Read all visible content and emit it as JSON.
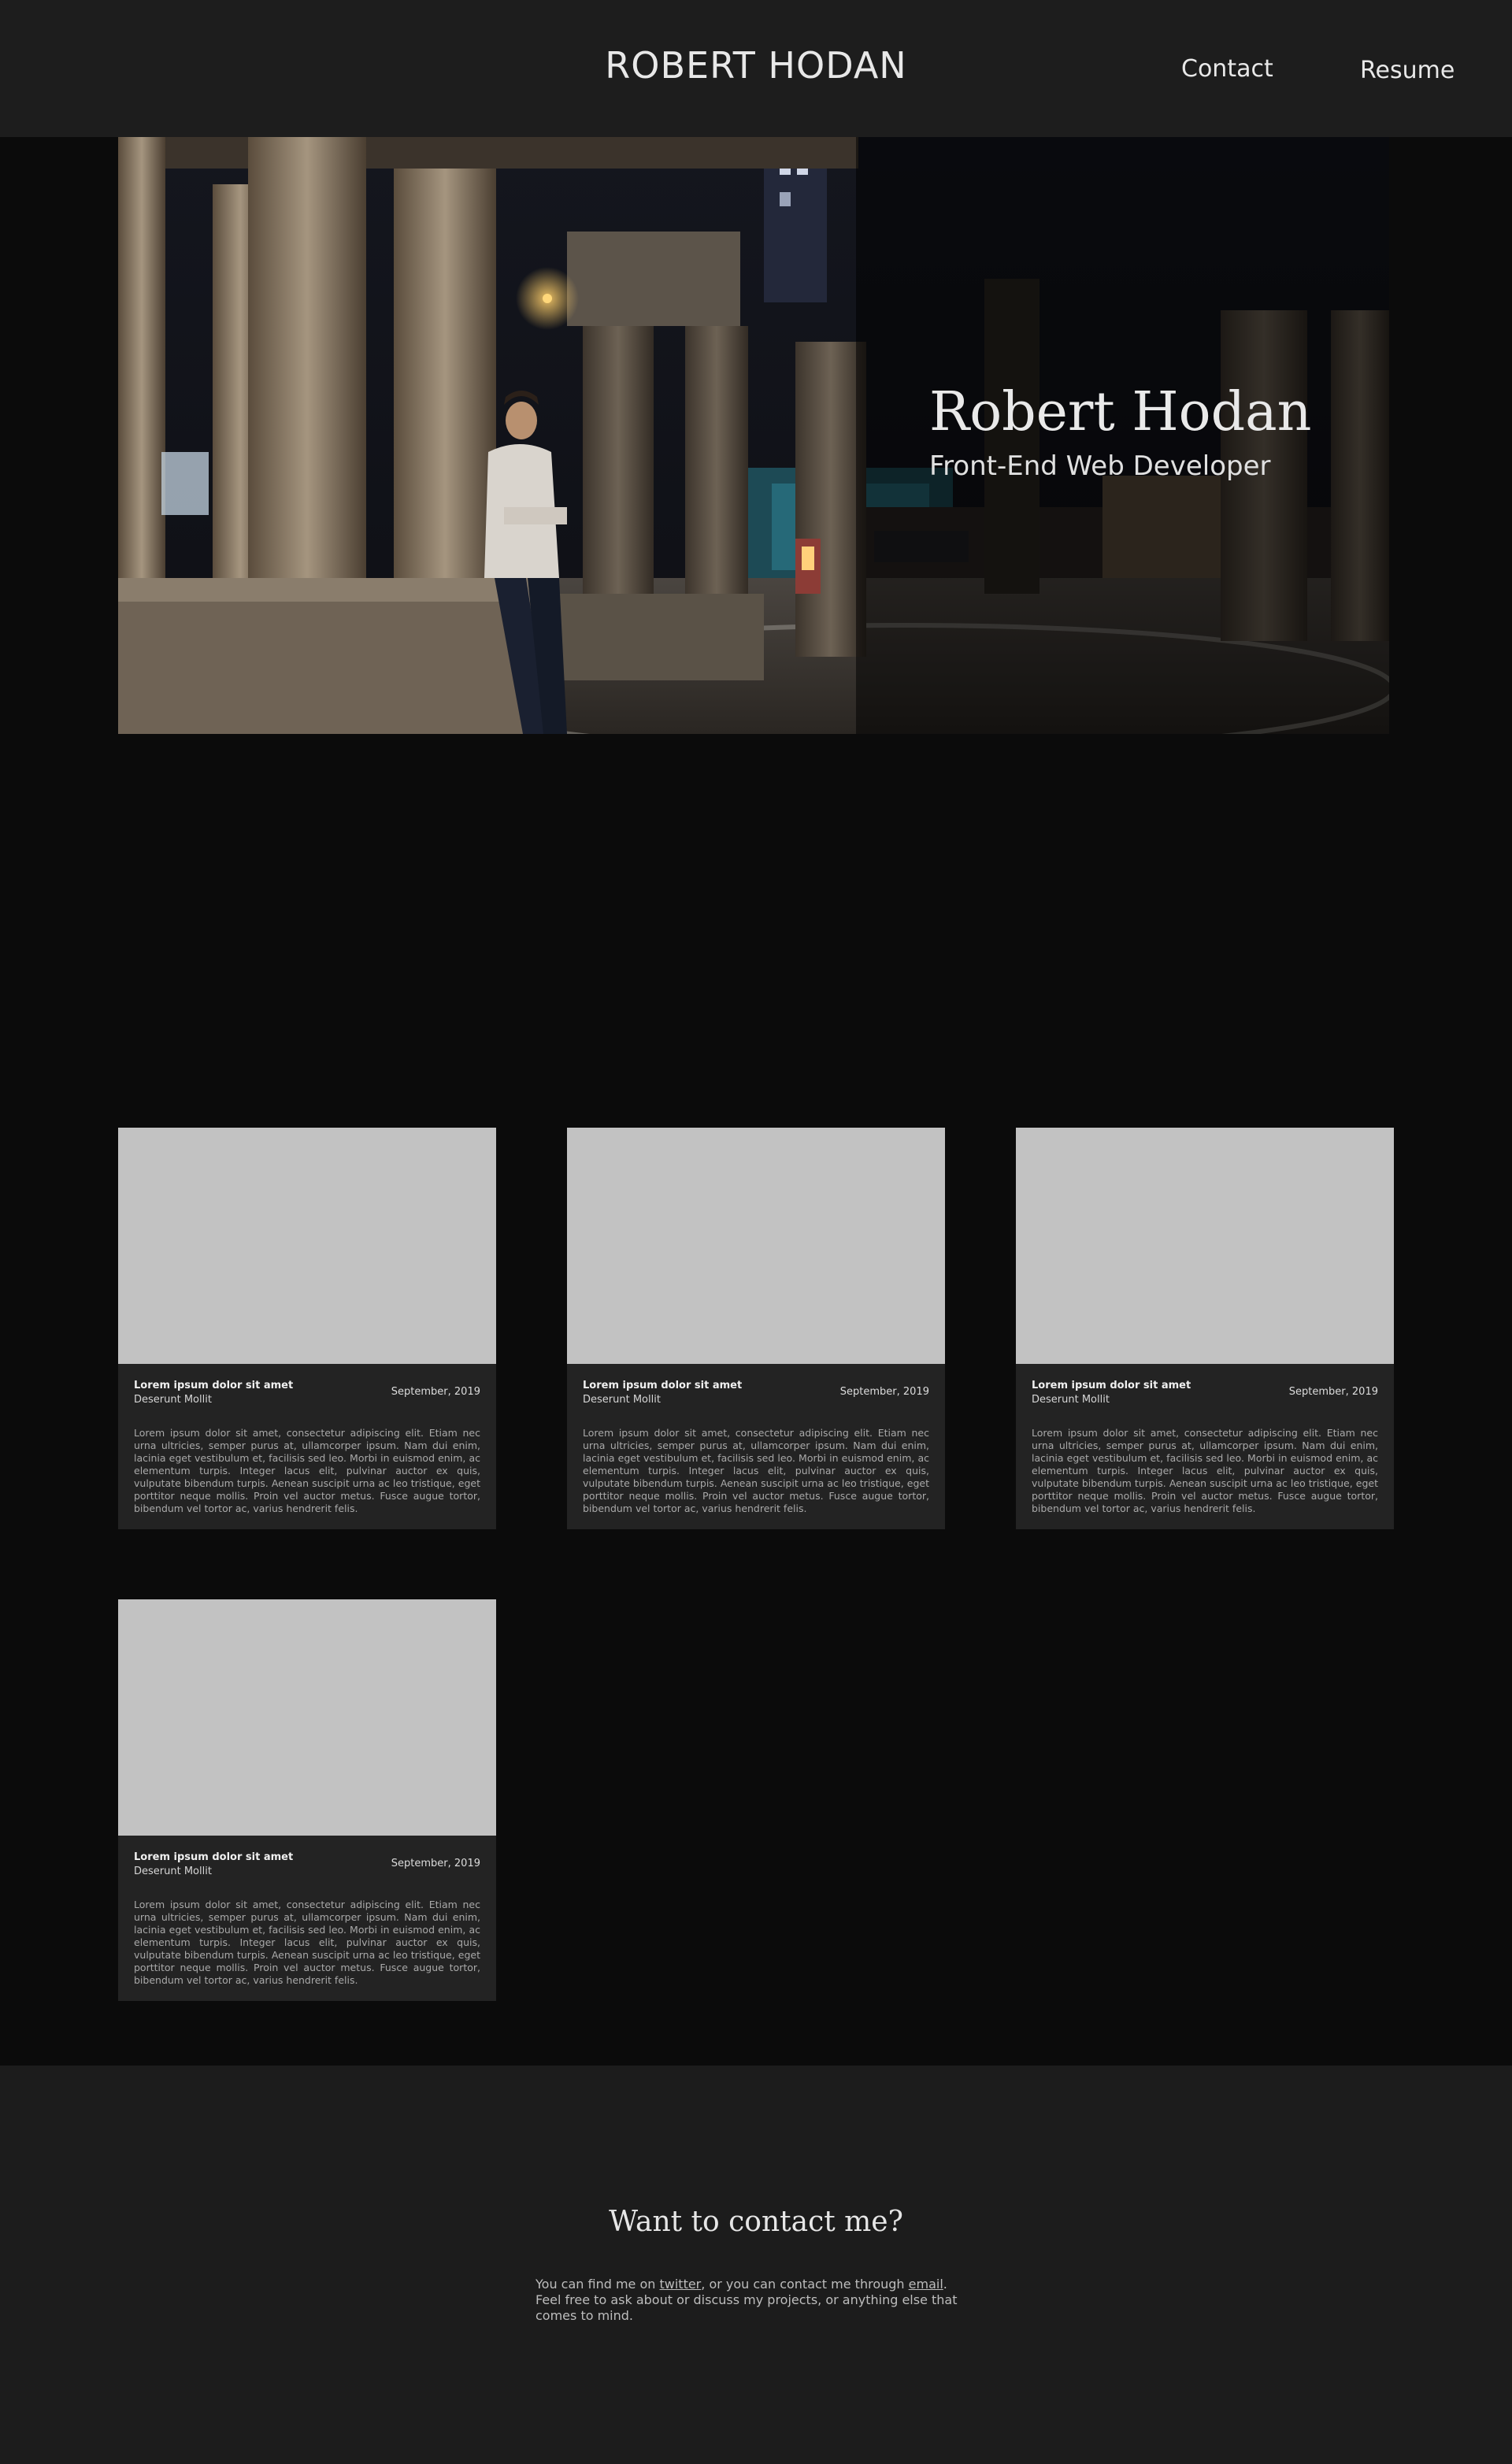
{
  "header": {
    "site_title": "ROBERT HODAN",
    "nav": {
      "contact": "Contact",
      "resume": "Resume"
    }
  },
  "hero": {
    "name": "Robert Hodan",
    "role": "Front-End Web Developer"
  },
  "cards": [
    {
      "title": "Lorem ipsum dolor sit amet",
      "subtitle": "Deserunt Mollit",
      "date": "September, 2019",
      "body": "Lorem ipsum dolor sit amet, consectetur adipiscing elit. Etiam nec urna ultricies, semper purus at, ullamcorper ipsum. Nam dui enim, lacinia eget vestibulum et, facilisis sed leo. Morbi in euismod enim, ac elementum turpis. Integer lacus elit, pulvinar auctor ex quis, vulputate bibendum turpis. Aenean suscipit urna ac leo tristique, eget porttitor neque mollis. Proin vel auctor metus. Fusce augue tortor, bibendum vel tortor ac, varius hendrerit felis."
    },
    {
      "title": "Lorem ipsum dolor sit amet",
      "subtitle": "Deserunt Mollit",
      "date": "September, 2019",
      "body": "Lorem ipsum dolor sit amet, consectetur adipiscing elit. Etiam nec urna ultricies, semper purus at, ullamcorper ipsum. Nam dui enim, lacinia eget vestibulum et, facilisis sed leo. Morbi in euismod enim, ac elementum turpis. Integer lacus elit, pulvinar auctor ex quis, vulputate bibendum turpis. Aenean suscipit urna ac leo tristique, eget porttitor neque mollis. Proin vel auctor metus. Fusce augue tortor, bibendum vel tortor ac, varius hendrerit felis."
    },
    {
      "title": "Lorem ipsum dolor sit amet",
      "subtitle": "Deserunt Mollit",
      "date": "September, 2019",
      "body": "Lorem ipsum dolor sit amet, consectetur adipiscing elit. Etiam nec urna ultricies, semper purus at, ullamcorper ipsum. Nam dui enim, lacinia eget vestibulum et, facilisis sed leo. Morbi in euismod enim, ac elementum turpis. Integer lacus elit, pulvinar auctor ex quis, vulputate bibendum turpis. Aenean suscipit urna ac leo tristique, eget porttitor neque mollis. Proin vel auctor metus. Fusce augue tortor, bibendum vel tortor ac, varius hendrerit felis."
    },
    {
      "title": "Lorem ipsum dolor sit amet",
      "subtitle": "Deserunt Mollit",
      "date": "September, 2019",
      "body": "Lorem ipsum dolor sit amet, consectetur adipiscing elit. Etiam nec urna ultricies, semper purus at, ullamcorper ipsum. Nam dui enim, lacinia eget vestibulum et, facilisis sed leo. Morbi in euismod enim, ac elementum turpis. Integer lacus elit, pulvinar auctor ex quis, vulputate bibendum turpis. Aenean suscipit urna ac leo tristique, eget porttitor neque mollis. Proin vel auctor metus. Fusce augue tortor, bibendum vel tortor ac, varius hendrerit felis."
    }
  ],
  "contact": {
    "heading": "Want to contact me?",
    "text_before": "You can find me on ",
    "twitter_link": "twitter",
    "text_middle": ", or you can contact me through ",
    "email_link": "email",
    "text_after": ". Feel free to ask about or discuss my projects, or anything else that comes to mind."
  },
  "colors": {
    "page_background": "#0b0b0b",
    "header_background": "#1d1d1d",
    "card_background": "#232323",
    "card_image_placeholder": "#c2c2c2",
    "footer_background": "#1c1c1c"
  }
}
